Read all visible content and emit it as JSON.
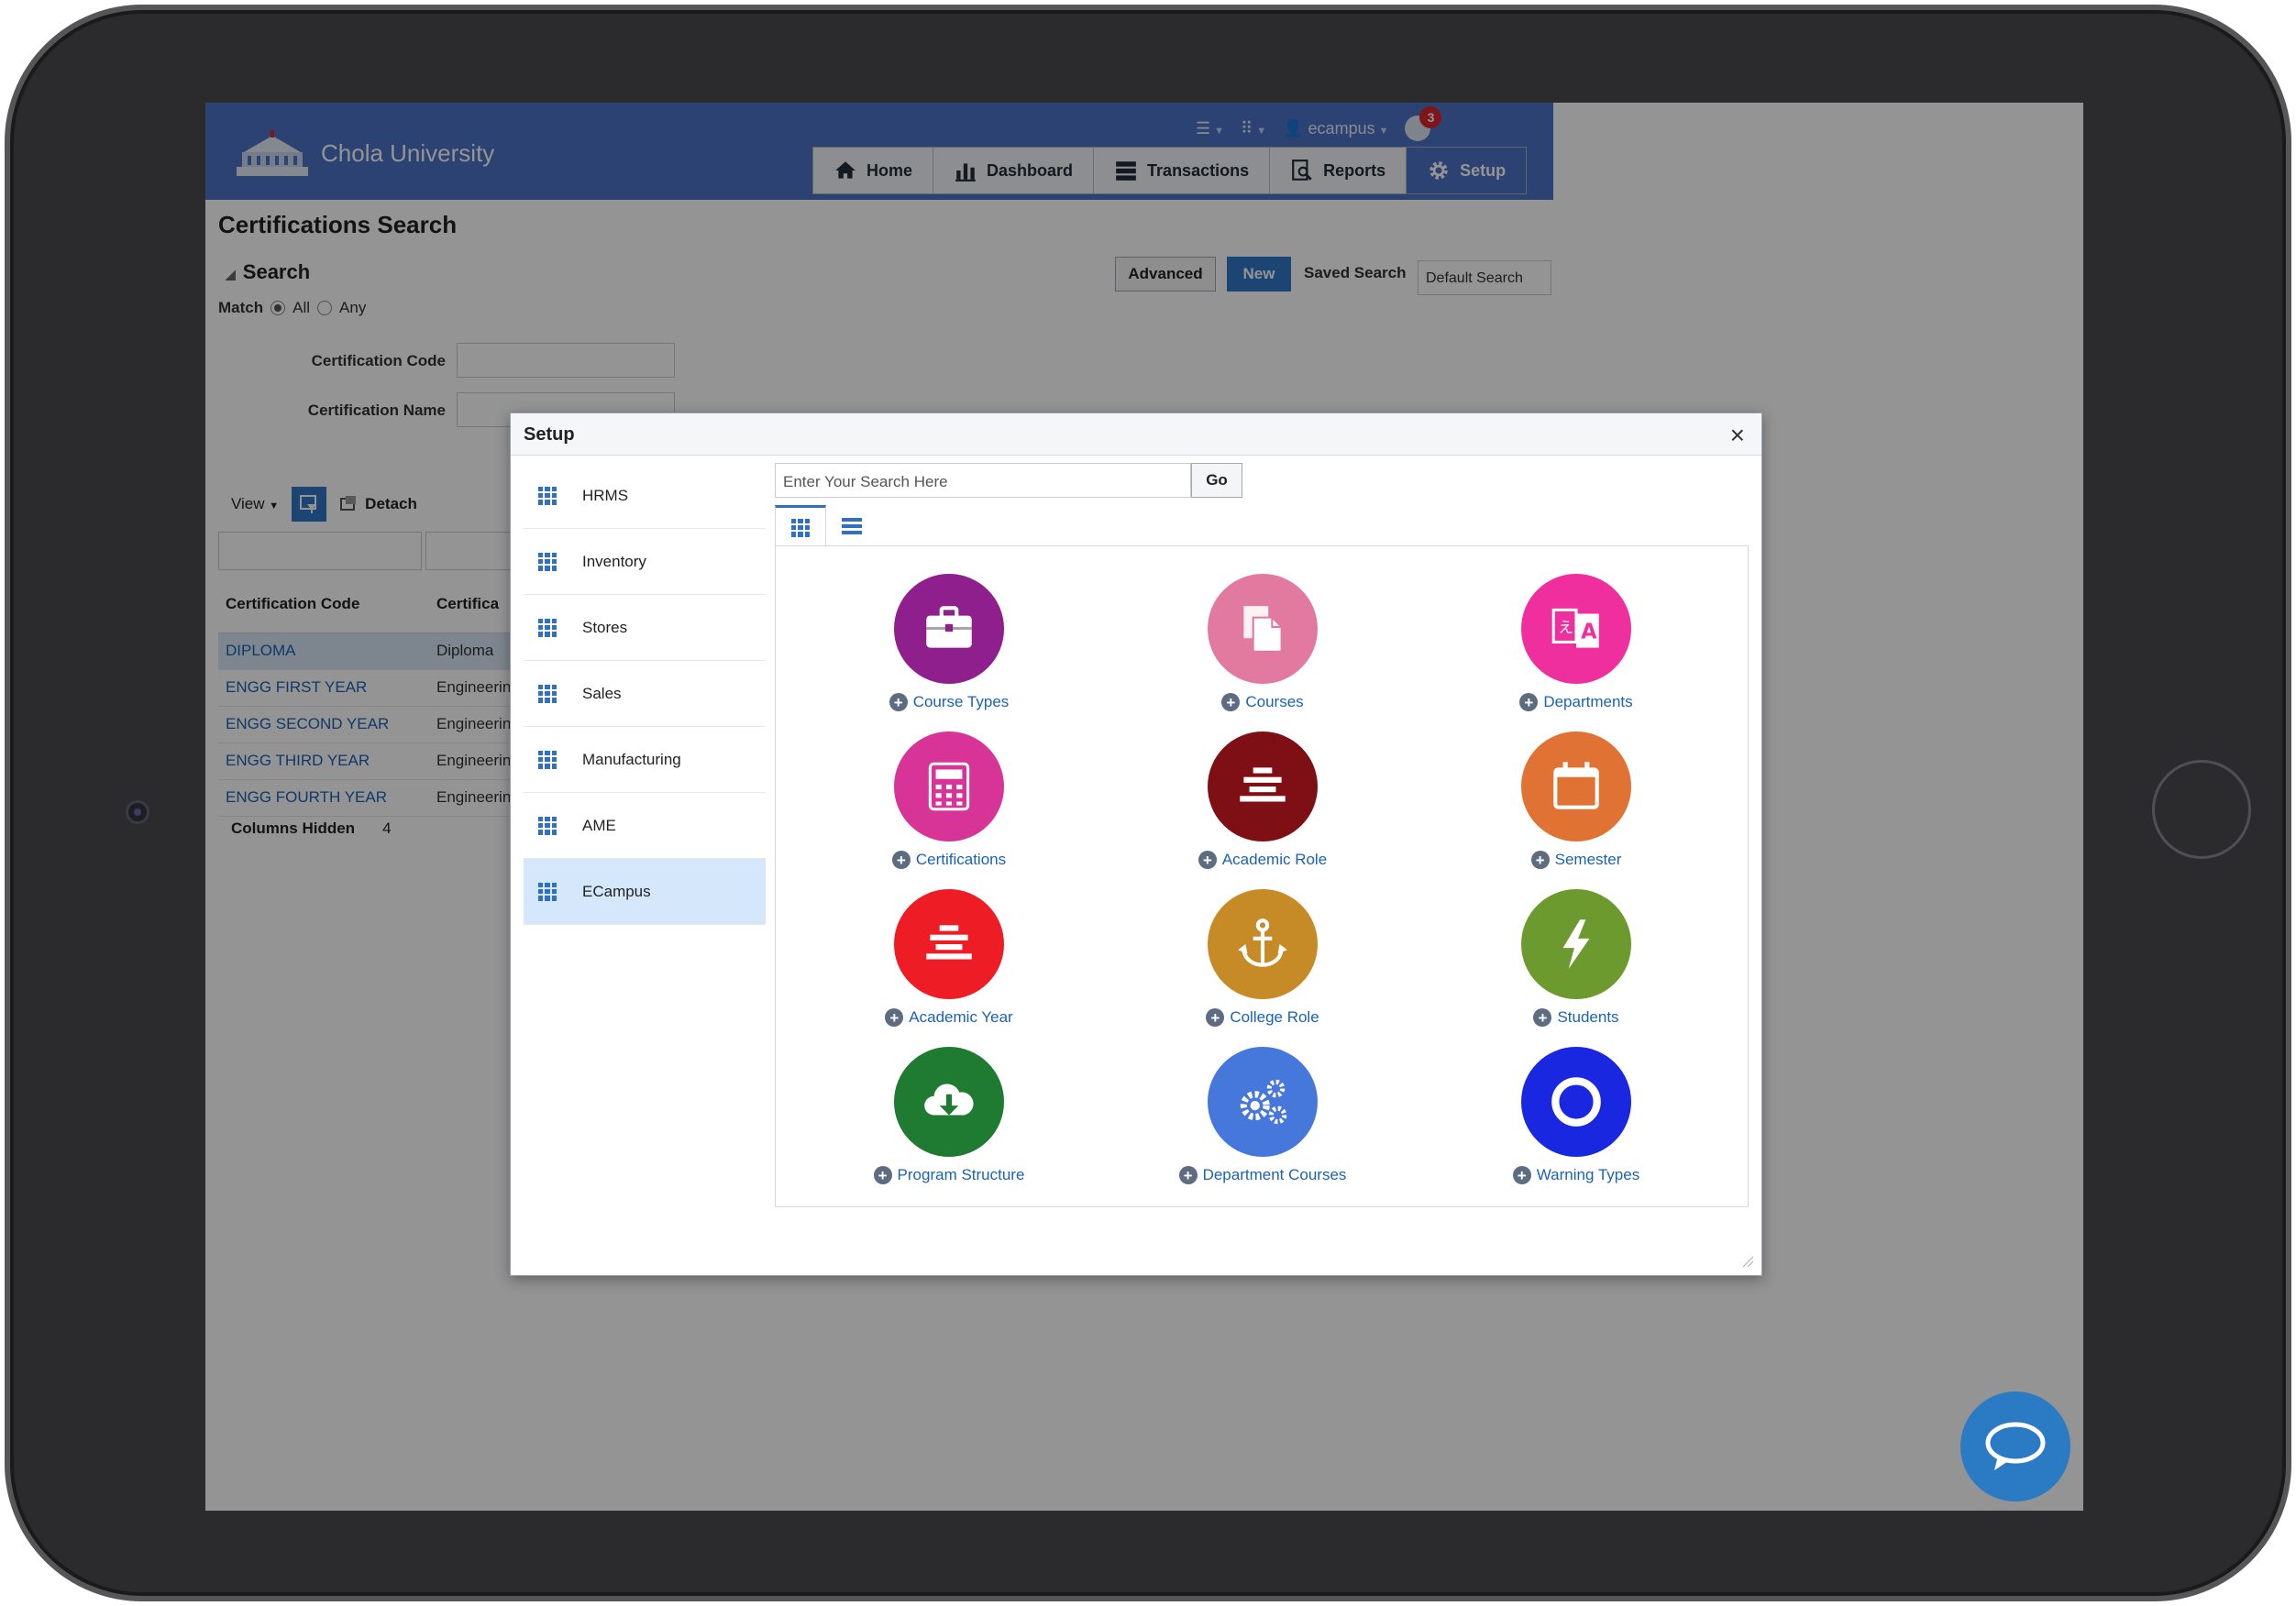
{
  "header": {
    "brand": "Chola University",
    "user": "ecampus",
    "notification_count": "3",
    "nav": [
      {
        "label": "Home"
      },
      {
        "label": "Dashboard"
      },
      {
        "label": "Transactions"
      },
      {
        "label": "Reports"
      },
      {
        "label": "Setup"
      }
    ],
    "active_nav": "Setup"
  },
  "page": {
    "title": "Certifications Search",
    "search_heading": "Search",
    "match_label": "Match",
    "match_all": "All",
    "match_any": "Any",
    "fields": [
      {
        "label": "Certification Code"
      },
      {
        "label": "Certification Name"
      }
    ],
    "advanced_label": "Advanced",
    "new_label": "New",
    "saved_search_label": "Saved Search",
    "saved_search_value": "Default Search"
  },
  "table": {
    "view_label": "View",
    "detach_label": "Detach",
    "columns": [
      "Certification Code",
      "Certifica"
    ],
    "rows": [
      {
        "code": "DIPLOMA",
        "name": "Diploma"
      },
      {
        "code": "ENGG FIRST YEAR",
        "name": "Engineerin"
      },
      {
        "code": "ENGG SECOND YEAR",
        "name": "Engineerin"
      },
      {
        "code": "ENGG THIRD YEAR",
        "name": "Engineerin"
      },
      {
        "code": "ENGG FOURTH YEAR",
        "name": "Engineerin"
      }
    ],
    "columns_hidden_label": "Columns Hidden",
    "columns_hidden_count": "4"
  },
  "dialog": {
    "title": "Setup",
    "side_items": [
      {
        "label": "HRMS"
      },
      {
        "label": "Inventory"
      },
      {
        "label": "Stores"
      },
      {
        "label": "Sales"
      },
      {
        "label": "Manufacturing"
      },
      {
        "label": "AME"
      },
      {
        "label": "ECampus"
      }
    ],
    "active_side_item": "ECampus",
    "search_placeholder": "Enter Your Search Here",
    "go_label": "Go",
    "tiles": [
      {
        "label": "Course Types",
        "icon": "briefcase-icon",
        "color": "#8e1f8c"
      },
      {
        "label": "Courses",
        "icon": "copy-icon",
        "color": "#e27aa0"
      },
      {
        "label": "Departments",
        "icon": "translate-icon",
        "color": "#ef2f9e"
      },
      {
        "label": "Certifications",
        "icon": "calculator-icon",
        "color": "#d83397"
      },
      {
        "label": "Academic Role",
        "icon": "align-center-icon",
        "color": "#7d0f15"
      },
      {
        "label": "Semester",
        "icon": "calendar-icon",
        "color": "#e07334"
      },
      {
        "label": "Academic Year",
        "icon": "align-center-icon",
        "color": "#ee1c25"
      },
      {
        "label": "College Role",
        "icon": "anchor-icon",
        "color": "#c68b27"
      },
      {
        "label": "Students",
        "icon": "lightning-icon",
        "color": "#6d9a2e"
      },
      {
        "label": "Program Structure",
        "icon": "cloud-download-icon",
        "color": "#1f7a32"
      },
      {
        "label": "Department Courses",
        "icon": "gears-icon",
        "color": "#4677db"
      },
      {
        "label": "Warning Types",
        "icon": "ring-icon",
        "color": "#1927e0"
      }
    ]
  },
  "colors": {
    "header_blue": "#4a73c4",
    "accent_blue": "#3277c9",
    "link_blue": "#1a63b3"
  }
}
